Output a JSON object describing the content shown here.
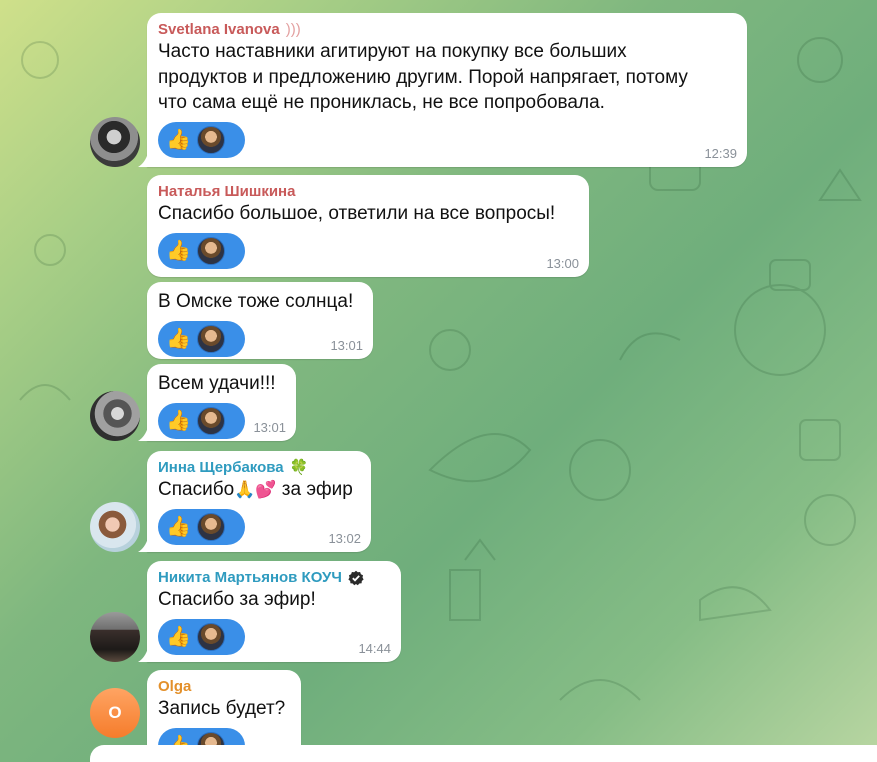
{
  "colors": {
    "reaction_bg": "#3a8fe8",
    "sender_svetlana": "#c85a5a",
    "sender_natalia": "#c85a5a",
    "sender_inna": "#2f9bbf",
    "sender_nikita": "#2f9bbf",
    "sender_olga": "#e3902b",
    "time": "#8a9199"
  },
  "messages": [
    {
      "sender": "Svetlana Ivanova",
      "sender_suffix": ")))",
      "lines": [
        "Часто наставники агитируют на покупку все больших",
        "продуктов и предложению другим. Порой напрягает, потому",
        "что сама ещё не прониклась, не все попробовала."
      ],
      "reaction_icon": "👍",
      "time": "12:39"
    },
    {
      "sender": "Наталья Шишкина",
      "lines": [
        "Спасибо большое, ответили на все вопросы!"
      ],
      "reaction_icon": "👍",
      "time": "13:00"
    },
    {
      "lines": [
        "В Омске тоже солнца!"
      ],
      "reaction_icon": "👍",
      "time": "13:01"
    },
    {
      "lines": [
        "Всем удачи!!!"
      ],
      "reaction_icon": "👍",
      "time": "13:01"
    },
    {
      "sender": "Инна Щербакова",
      "sender_emoji": "🍀",
      "text_before": "Спасибо",
      "text_emoji": "🙏💕",
      "text_after": " за эфир",
      "reaction_icon": "👍",
      "time": "13:02"
    },
    {
      "sender": "Никита Мартьянов КОУЧ",
      "sender_badge": "verified-badge-icon",
      "lines": [
        "Спасибо за эфир!"
      ],
      "reaction_icon": "👍",
      "time": "14:44"
    },
    {
      "sender": "Olga",
      "avatar_letter": "O",
      "lines": [
        "Запись будет?"
      ],
      "reaction_icon": "👍"
    }
  ]
}
